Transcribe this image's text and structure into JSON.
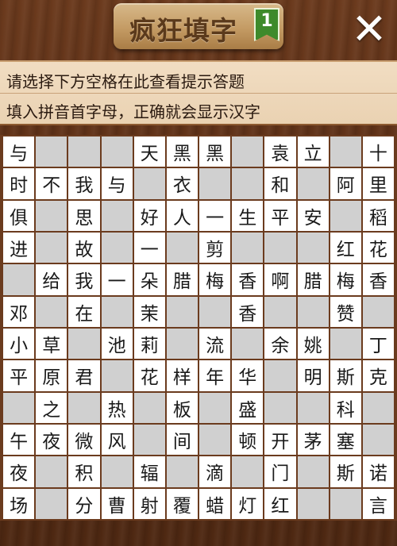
{
  "header": {
    "title": "疯狂填字",
    "level": "1",
    "close_icon": "close-x-icon"
  },
  "hint": {
    "line1": "请选择下方空格在此查看提示答题",
    "line2": "填入拼音首字母，正确就会显示汉字"
  },
  "grid": {
    "rows": 12,
    "cols": 12,
    "cells": [
      [
        "与",
        "",
        "",
        "",
        "天",
        "黑",
        "黑",
        "",
        "袁",
        "立",
        "",
        "十"
      ],
      [
        "时",
        "不",
        "我",
        "与",
        "",
        "衣",
        "",
        "",
        "和",
        "",
        "阿",
        "里"
      ],
      [
        "俱",
        "",
        "思",
        "",
        "好",
        "人",
        "一",
        "生",
        "平",
        "安",
        "",
        "稻"
      ],
      [
        "进",
        "",
        "故",
        "",
        "一",
        "",
        "剪",
        "",
        "",
        "",
        "红",
        "花"
      ],
      [
        "",
        "给",
        "我",
        "一",
        "朵",
        "腊",
        "梅",
        "香",
        "啊",
        "腊",
        "梅",
        "香"
      ],
      [
        "邓",
        "",
        "在",
        "",
        "茉",
        "",
        "",
        "香",
        "",
        "",
        "赞",
        ""
      ],
      [
        "小",
        "草",
        "",
        "池",
        "莉",
        "",
        "流",
        "",
        "余",
        "姚",
        "",
        "丁"
      ],
      [
        "平",
        "原",
        "君",
        "",
        "花",
        "样",
        "年",
        "华",
        "",
        "明",
        "斯",
        "克"
      ],
      [
        "",
        "之",
        "",
        "热",
        "",
        "板",
        "",
        "盛",
        "",
        "",
        "科",
        ""
      ],
      [
        "午",
        "夜",
        "微",
        "风",
        "",
        "间",
        "",
        "顿",
        "开",
        "茅",
        "塞",
        ""
      ],
      [
        "夜",
        "",
        "积",
        "",
        "辐",
        "",
        "滴",
        "",
        "门",
        "",
        "斯",
        "诺"
      ],
      [
        "场",
        "",
        "分",
        "曹",
        "射",
        "覆",
        "蜡",
        "灯",
        "红",
        "",
        "",
        "言"
      ]
    ]
  }
}
